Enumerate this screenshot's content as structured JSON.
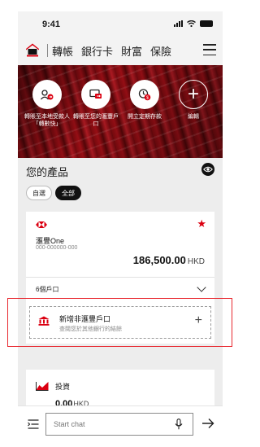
{
  "status_bar": {
    "time": "9:41"
  },
  "nav": {
    "items": [
      "轉帳",
      "銀行卡",
      "財富",
      "保險"
    ]
  },
  "quick_actions": [
    {
      "label": "轉賬至本地受款人「轉數快」",
      "icon": "transfer-local-icon"
    },
    {
      "label": "轉賬至您的滙豐戶口",
      "icon": "transfer-own-icon"
    },
    {
      "label": "開立定期存款",
      "icon": "time-deposit-icon"
    },
    {
      "label": "編輯",
      "icon": "plus-icon"
    }
  ],
  "products": {
    "title": "您的產品",
    "filters": [
      {
        "label": "自選",
        "active": false
      },
      {
        "label": "全部",
        "active": true
      }
    ]
  },
  "account": {
    "name": "滙豐One",
    "number": "000-000000-000",
    "balance": "186,500.00",
    "currency": "HKD",
    "count_label": "6個戶口"
  },
  "add_external": {
    "title": "新增非滙豐戶口",
    "subtitle": "查閱您於其他銀行的結餘"
  },
  "investment": {
    "title": "投資",
    "value": "0.00",
    "currency": "HKD"
  },
  "chat": {
    "placeholder": "Start chat"
  },
  "colors": {
    "brand_red": "#db0011",
    "highlight": "#e8282f"
  }
}
